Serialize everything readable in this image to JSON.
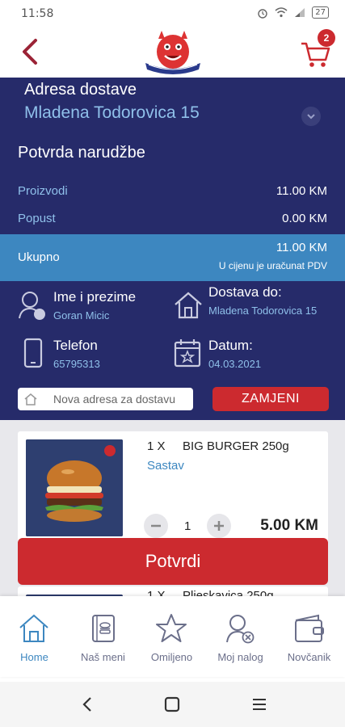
{
  "status_bar": {
    "time": "11:58",
    "battery": "27"
  },
  "header": {
    "cart_count": "2",
    "logo_icon": "restaurant-logo-icon"
  },
  "delivery": {
    "address_label": "Adresa dostave",
    "address_value": "Mladena Todorovica 15"
  },
  "order": {
    "title": "Potvrda narudžbe",
    "products_label": "Proizvodi",
    "products_value": "11.00 KM",
    "discount_label": "Popust",
    "discount_value": "0.00 KM",
    "total_label": "Ukupno",
    "total_value": "11.00 KM",
    "vat_note": "U cijenu je uračunat PDV"
  },
  "info": {
    "name_title": "Ime i prezime",
    "name_value": "Goran Micic",
    "delivery_to_title": "Dostava do:",
    "delivery_to_value": "Mladena Todorovica 15",
    "phone_title": "Telefon",
    "phone_value": "65795313",
    "date_title": "Datum:",
    "date_value": "04.03.2021"
  },
  "new_address": {
    "placeholder": "Nova adresa za dostavu",
    "button": "ZAMJENI"
  },
  "cart_items": [
    {
      "qty": "1 X",
      "name": "BIG BURGER 250g",
      "details": "Sastav",
      "stepper_value": "1",
      "price": "5.00 KM"
    },
    {
      "qty": "1 X",
      "name": "Pljeskavica 250g"
    }
  ],
  "confirm_button": "Potvrdi",
  "bottom_nav": [
    {
      "label": "Home",
      "icon": "home-icon",
      "active": true
    },
    {
      "label": "Naš meni",
      "icon": "menu-book-icon",
      "active": false
    },
    {
      "label": "Omiljeno",
      "icon": "star-icon",
      "active": false
    },
    {
      "label": "Moj nalog",
      "icon": "user-icon",
      "active": false
    },
    {
      "label": "Novčanik",
      "icon": "wallet-icon",
      "active": false
    }
  ],
  "colors": {
    "navy": "#262b6a",
    "accent_blue": "#3d87c0",
    "light_blue": "#8fc0ea",
    "red": "#cc2a2f"
  }
}
